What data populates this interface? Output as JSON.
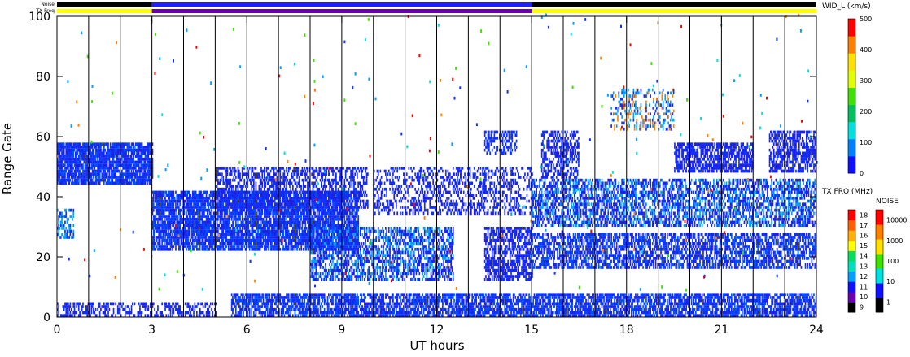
{
  "chart_data": {
    "type": "heatmap",
    "top_bar_labels": {
      "noise": "Noise",
      "tx_freq": "TX Freq"
    },
    "title": "",
    "xlabel": "UT hours",
    "ylabel": "Range Gate",
    "x_ticks": [
      0,
      3,
      6,
      9,
      12,
      15,
      18,
      21,
      24
    ],
    "y_ticks": [
      0,
      20,
      40,
      60,
      80,
      100
    ],
    "xlim": [
      0,
      24
    ],
    "ylim": [
      0,
      100
    ],
    "vertical_lines_hours": [
      1,
      2,
      3,
      4,
      5,
      6,
      7,
      8,
      9,
      10,
      11,
      12,
      13,
      14,
      15,
      16,
      17,
      18,
      19,
      20,
      21,
      22,
      23
    ],
    "tx_freq_segments": [
      {
        "start": 0,
        "end": 3,
        "color": "#ffff00"
      },
      {
        "start": 3,
        "end": 15,
        "color": "#6a00b0"
      },
      {
        "start": 15,
        "end": 24,
        "color": "#ffff00"
      }
    ],
    "noise_segments": [
      {
        "start": 0,
        "end": 3,
        "color": "#000000"
      },
      {
        "start": 3,
        "end": 15,
        "color": "#2020ff"
      },
      {
        "start": 15,
        "end": 24,
        "color": "#000000"
      }
    ],
    "echo_regions": [
      {
        "x0": 0.0,
        "x1": 3.0,
        "y0": 44,
        "y1": 58,
        "density": 0.85,
        "colors": [
          "#1030ff",
          "#0050ff",
          "#2020e0"
        ]
      },
      {
        "x0": 0.0,
        "x1": 0.5,
        "y0": 26,
        "y1": 36,
        "density": 0.5,
        "colors": [
          "#1030ff",
          "#00a0ff"
        ]
      },
      {
        "x0": 3.0,
        "x1": 9.5,
        "y0": 22,
        "y1": 42,
        "density": 0.8,
        "colors": [
          "#1030ff",
          "#2020e0",
          "#0050ff"
        ]
      },
      {
        "x0": 5.0,
        "x1": 9.8,
        "y0": 36,
        "y1": 50,
        "density": 0.5,
        "colors": [
          "#1030ff",
          "#2020e0"
        ]
      },
      {
        "x0": 5.5,
        "x1": 24.0,
        "y0": 0,
        "y1": 8,
        "density": 0.7,
        "colors": [
          "#1030ff",
          "#2020e0",
          "#0050ff"
        ]
      },
      {
        "x0": 0.0,
        "x1": 5.0,
        "y0": 0,
        "y1": 5,
        "density": 0.4,
        "colors": [
          "#1030ff",
          "#2020e0"
        ]
      },
      {
        "x0": 8.0,
        "x1": 12.5,
        "y0": 12,
        "y1": 30,
        "density": 0.55,
        "colors": [
          "#1030ff",
          "#2020e0",
          "#00a0ff"
        ]
      },
      {
        "x0": 10.0,
        "x1": 15.0,
        "y0": 34,
        "y1": 50,
        "density": 0.35,
        "colors": [
          "#1030ff",
          "#2020e0"
        ]
      },
      {
        "x0": 13.5,
        "x1": 15.0,
        "y0": 12,
        "y1": 30,
        "density": 0.6,
        "colors": [
          "#1030ff",
          "#2020e0"
        ]
      },
      {
        "x0": 15.0,
        "x1": 24.0,
        "y0": 16,
        "y1": 28,
        "density": 0.6,
        "colors": [
          "#1030ff",
          "#2020e0",
          "#0050ff"
        ]
      },
      {
        "x0": 15.0,
        "x1": 24.0,
        "y0": 30,
        "y1": 46,
        "density": 0.55,
        "colors": [
          "#1030ff",
          "#2020e0",
          "#00a0ff"
        ]
      },
      {
        "x0": 19.5,
        "x1": 22.0,
        "y0": 48,
        "y1": 58,
        "density": 0.7,
        "colors": [
          "#1030ff",
          "#2020e0"
        ]
      },
      {
        "x0": 22.5,
        "x1": 24.0,
        "y0": 48,
        "y1": 62,
        "density": 0.6,
        "colors": [
          "#1030ff",
          "#2020e0"
        ]
      },
      {
        "x0": 17.5,
        "x1": 19.5,
        "y0": 62,
        "y1": 76,
        "density": 0.3,
        "colors": [
          "#1030ff",
          "#ff8000",
          "#00a0ff"
        ]
      },
      {
        "x0": 15.3,
        "x1": 16.5,
        "y0": 46,
        "y1": 62,
        "density": 0.5,
        "colors": [
          "#1030ff",
          "#2020e0"
        ]
      },
      {
        "x0": 13.5,
        "x1": 14.5,
        "y0": 54,
        "y1": 62,
        "density": 0.5,
        "colors": [
          "#1030ff"
        ]
      }
    ],
    "colorbars": [
      {
        "title": "WID_L (km/s)",
        "ticks": [
          "0",
          "100",
          "200",
          "300",
          "400",
          "500"
        ],
        "colors": [
          "#1010ff",
          "#0080ff",
          "#00e0e0",
          "#00c060",
          "#40e000",
          "#e0ff00",
          "#ffe000",
          "#ff8000",
          "#ff0000"
        ]
      },
      {
        "title": "TX FRQ (MHz)",
        "ticks": [
          "9",
          "10",
          "11",
          "12",
          "13",
          "14",
          "15",
          "16",
          "17",
          "18"
        ],
        "colors": [
          "#000000",
          "#6a00b0",
          "#1010ff",
          "#00a0ff",
          "#00e0c0",
          "#00e060",
          "#ffff00",
          "#ffb000",
          "#ff6000",
          "#ff0000"
        ]
      },
      {
        "title": "NOISE",
        "ticks": [
          "1",
          "10",
          "100",
          "1000",
          "10000"
        ],
        "colors": [
          "#000000",
          "#1010ff",
          "#00e0e0",
          "#40e000",
          "#ffe000",
          "#ff8000",
          "#ff0000"
        ]
      }
    ]
  }
}
